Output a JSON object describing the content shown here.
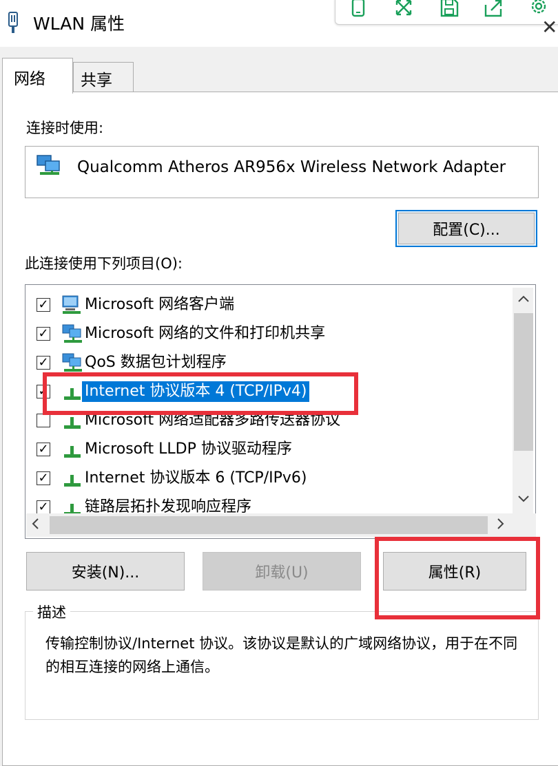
{
  "window": {
    "title": "WLAN 属性",
    "close_glyph": "✕"
  },
  "tabs": [
    {
      "label": "网络",
      "active": true
    },
    {
      "label": "共享",
      "active": false
    }
  ],
  "connection": {
    "label": "连接时使用:",
    "adapter_name": "Qualcomm Atheros AR956x Wireless Network Adapter",
    "configure_button": "配置(C)..."
  },
  "items_label": "此连接使用下列项目(O):",
  "items": [
    {
      "label": "Microsoft 网络客户端",
      "checked": true,
      "icon": "network-client-icon"
    },
    {
      "label": "Microsoft 网络的文件和打印机共享",
      "checked": true,
      "icon": "file-share-icon"
    },
    {
      "label": "QoS 数据包计划程序",
      "checked": true,
      "icon": "qos-icon"
    },
    {
      "label": "Internet 协议版本 4 (TCP/IPv4)",
      "checked": true,
      "selected": true,
      "icon": "protocol-icon"
    },
    {
      "label": "Microsoft 网络适配器多路传送器协议",
      "checked": false,
      "icon": "protocol-icon"
    },
    {
      "label": "Microsoft LLDP 协议驱动程序",
      "checked": true,
      "icon": "protocol-icon"
    },
    {
      "label": "Internet 协议版本 6 (TCP/IPv6)",
      "checked": true,
      "icon": "protocol-icon"
    },
    {
      "label": "链路层拓扑发现响应程序",
      "checked": true,
      "icon": "protocol-icon"
    }
  ],
  "buttons": {
    "install": "安装(N)...",
    "uninstall": "卸载(U)",
    "properties": "属性(R)"
  },
  "description": {
    "legend": "描述",
    "text": "传输控制协议/Internet 协议。该协议是默认的广域网络协议，用于在不同的相互连接的网络上通信。"
  },
  "colors": {
    "selection": "#0078d7",
    "annotation": "#e8303a",
    "accent_border": "#0078d7"
  }
}
